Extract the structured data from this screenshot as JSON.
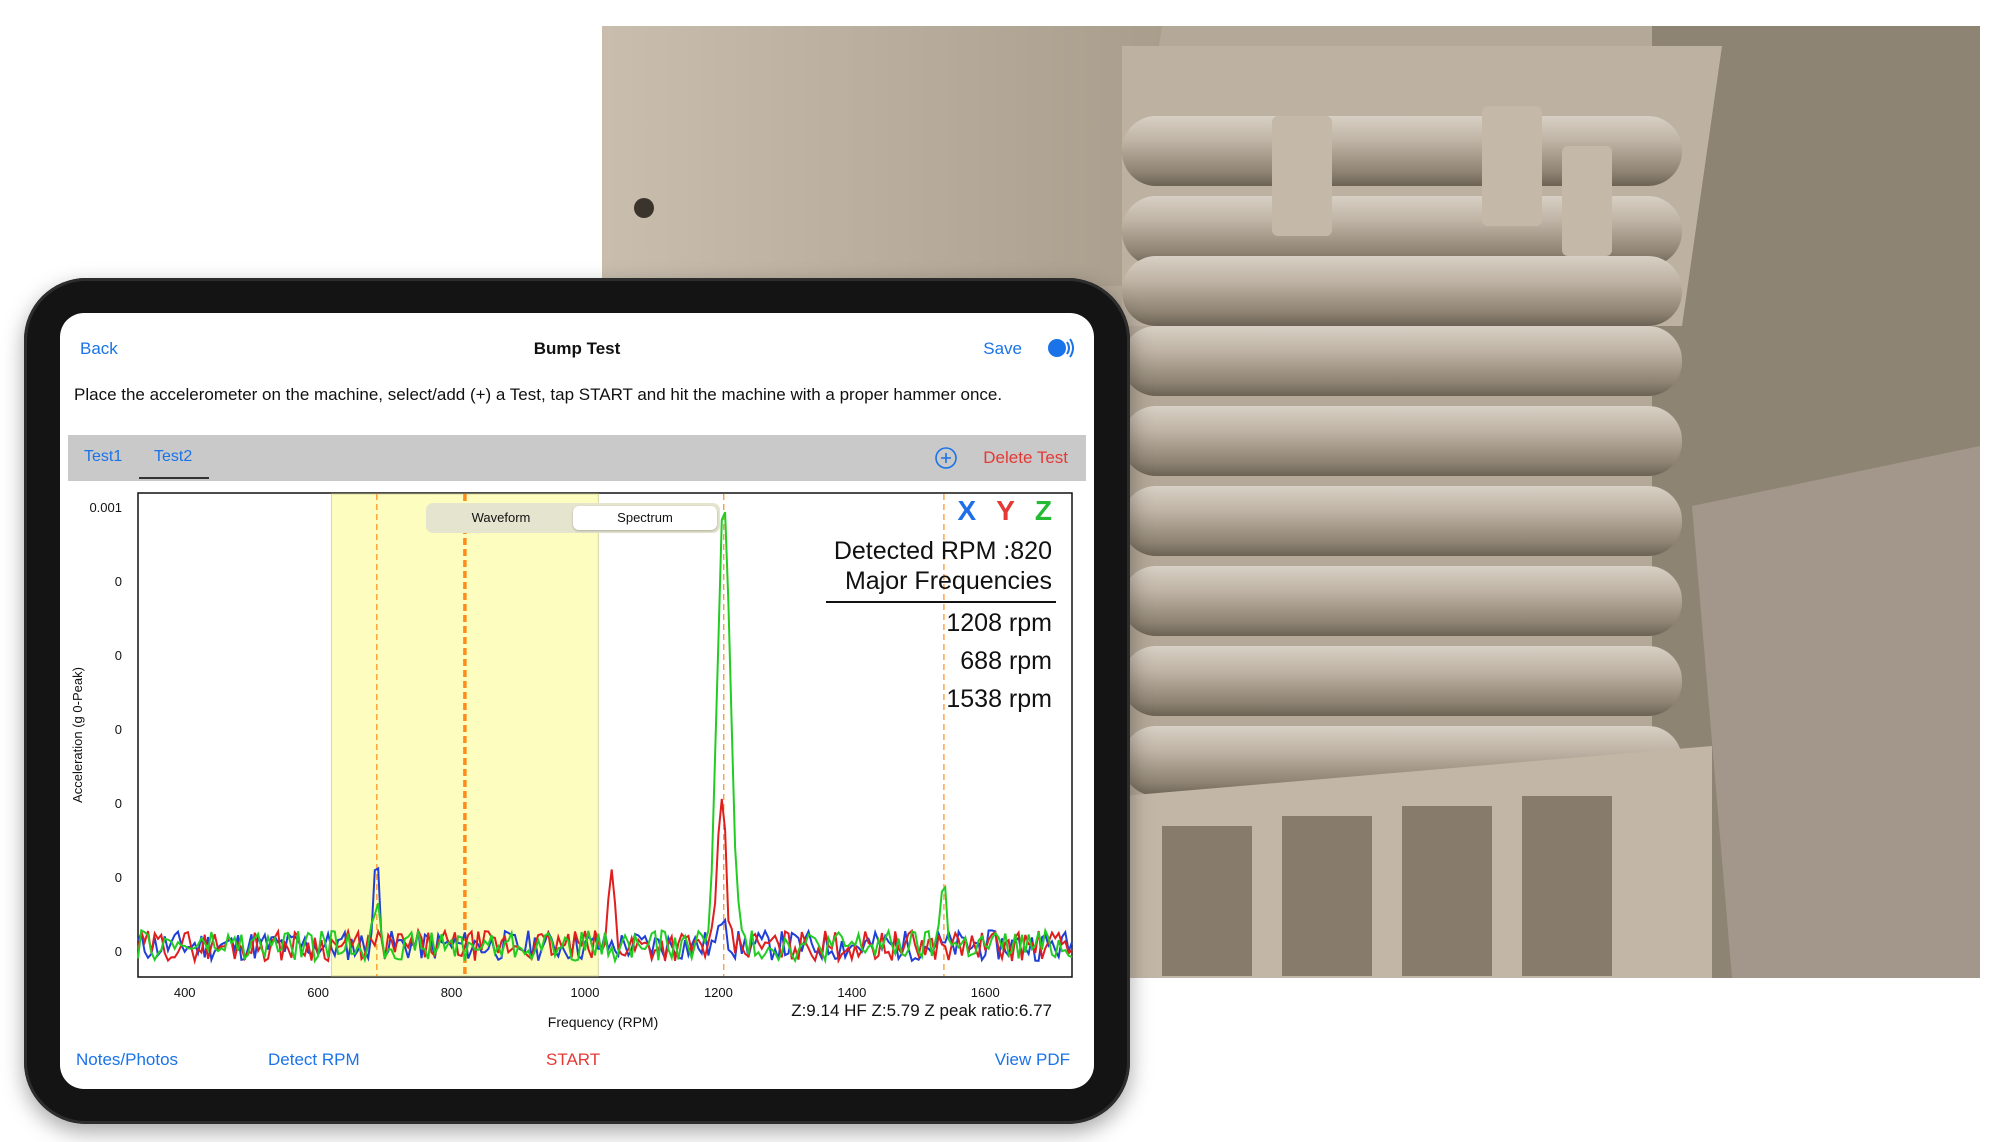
{
  "nav": {
    "back_label": "Back",
    "title": "Bump Test",
    "save_label": "Save"
  },
  "instructions": "Place the accelerometer on the machine, select/add (+) a Test, tap START and hit the machine with a proper hammer once.",
  "tabs": [
    {
      "label": "Test1",
      "selected": false
    },
    {
      "label": "Test2",
      "selected": true
    }
  ],
  "delete_label": "Delete Test",
  "segmented": {
    "options": [
      "Waveform",
      "Spectrum"
    ],
    "selected": "Spectrum"
  },
  "axis_legend": {
    "x": "X",
    "y": "Y",
    "z": "Z"
  },
  "detected_rpm": "Detected RPM :820",
  "major_frequencies_label": "Major Frequencies",
  "major_frequencies": [
    "1208 rpm",
    "688 rpm",
    "1538 rpm"
  ],
  "stats_line": "Z:9.14 HF Z:5.79 Z peak ratio:6.77",
  "toolbar": {
    "notes": "Notes/Photos",
    "detect": "Detect RPM",
    "start": "START",
    "pdf": "View PDF"
  },
  "colors": {
    "accent": "#1a73e8",
    "danger": "#e53935",
    "series_x": "#1f3fd8",
    "series_y": "#e01e1e",
    "series_z": "#22cc22",
    "series_avg": "#8a7fd0",
    "highlight_band": "#fdfdc0",
    "marker": "#ff8c1a"
  },
  "chart_data": {
    "type": "line",
    "xlabel": "Frequency (RPM)",
    "ylabel": "Acceleration (g 0-Peak)",
    "xlim": [
      330,
      1730
    ],
    "x_ticks": [
      400,
      600,
      800,
      1000,
      1200,
      1400,
      1600
    ],
    "y_tick_labels": [
      "0.001",
      "0",
      "0",
      "0",
      "0",
      "0",
      "0"
    ],
    "highlight_band": [
      620,
      1020
    ],
    "markers": [
      {
        "x": 688,
        "style": "dashed"
      },
      {
        "x": 820,
        "style": "dashed-bold"
      },
      {
        "x": 1208,
        "style": "dashed"
      },
      {
        "x": 1538,
        "style": "dashed"
      }
    ],
    "series": [
      {
        "name": "X",
        "peaks": [
          [
            688,
            0.19
          ],
          [
            1208,
            0.09
          ]
        ]
      },
      {
        "name": "Y",
        "peaks": [
          [
            1040,
            0.17
          ],
          [
            1200,
            0.17
          ],
          [
            1208,
            0.28
          ]
        ]
      },
      {
        "name": "Z",
        "peaks": [
          [
            1208,
            1.0
          ],
          [
            1538,
            0.16
          ],
          [
            688,
            0.12
          ]
        ]
      }
    ]
  }
}
